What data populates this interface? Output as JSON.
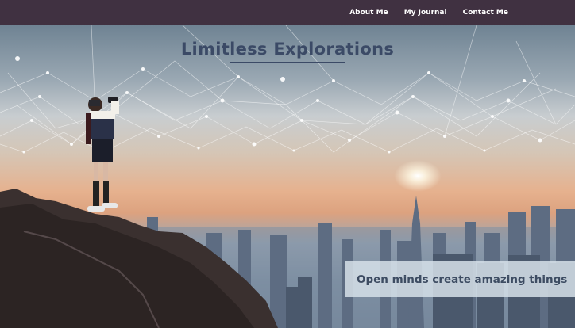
{
  "nav": {
    "items": [
      {
        "label": "About Me"
      },
      {
        "label": "My Journal"
      },
      {
        "label": "Contact Me"
      }
    ]
  },
  "hero": {
    "title": "Limitless Explorations",
    "tagline": "Open minds create amazing things"
  },
  "colors": {
    "navbar_bg": "#403141",
    "title_color": "#3b4a66",
    "tagline_color": "#3d4c62"
  }
}
